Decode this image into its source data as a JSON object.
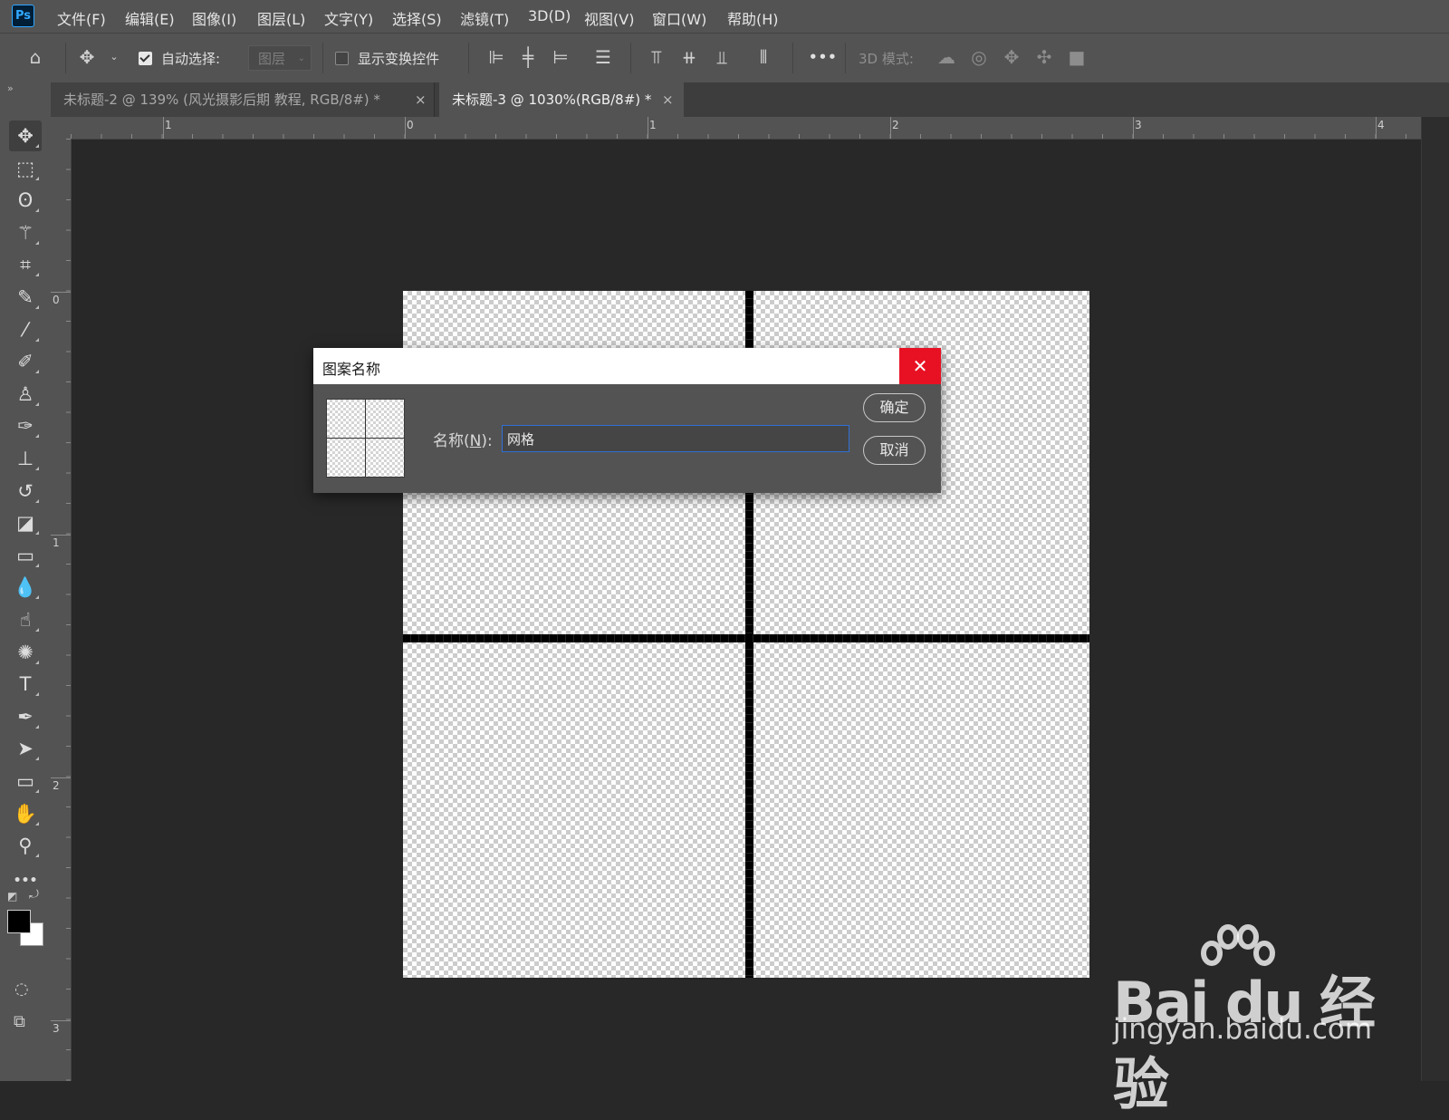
{
  "app": {
    "logo_text": "Ps"
  },
  "menu": [
    "文件(F)",
    "编辑(E)",
    "图像(I)",
    "图层(L)",
    "文字(Y)",
    "选择(S)",
    "滤镜(T)",
    "3D(D)",
    "视图(V)",
    "窗口(W)",
    "帮助(H)"
  ],
  "options_bar": {
    "auto_select_label": "自动选择:",
    "auto_select_checked": true,
    "layer_select_value": "图层",
    "show_transform_label": "显示变换控件",
    "show_transform_checked": false,
    "mode_3d_label": "3D 模式:",
    "more_label": "•••"
  },
  "tabs": [
    {
      "title": "未标题-2 @ 139% (风光摄影后期 教程, RGB/8#) *",
      "close": "×",
      "active": false
    },
    {
      "title": "未标题-3 @ 1030%(RGB/8#) *",
      "close": "×",
      "active": true
    }
  ],
  "rulers": {
    "horizontal": [
      "1",
      "0",
      "1",
      "2",
      "3",
      "4"
    ],
    "vertical": [
      "0",
      "1",
      "2",
      "3"
    ]
  },
  "toolbar": {
    "tools": [
      {
        "name": "move-tool",
        "glyph": "✥",
        "active": true
      },
      {
        "name": "marquee-tool",
        "glyph": "⬚"
      },
      {
        "name": "lasso-tool",
        "glyph": "ʘ"
      },
      {
        "name": "magic-wand-tool",
        "glyph": "⚚"
      },
      {
        "name": "crop-tool",
        "glyph": "⌗"
      },
      {
        "name": "eyedropper-tool",
        "glyph": "✎"
      },
      {
        "name": "healing-brush-tool",
        "glyph": "⁄"
      },
      {
        "name": "brush-tool",
        "glyph": "✐"
      },
      {
        "name": "clone-stamp-tool",
        "glyph": "♙"
      },
      {
        "name": "mixer-brush-tool",
        "glyph": "✑"
      },
      {
        "name": "stamp-tool",
        "glyph": "⊥"
      },
      {
        "name": "history-brush-tool",
        "glyph": "↺"
      },
      {
        "name": "eraser-tool",
        "glyph": "◪"
      },
      {
        "name": "gradient-tool",
        "glyph": "▭"
      },
      {
        "name": "blur-tool",
        "glyph": "💧"
      },
      {
        "name": "smudge-tool",
        "glyph": "☝"
      },
      {
        "name": "sponge-tool",
        "glyph": "✺"
      },
      {
        "name": "type-tool",
        "glyph": "T"
      },
      {
        "name": "pen-tool",
        "glyph": "✒"
      },
      {
        "name": "path-selection-tool",
        "glyph": "➤"
      },
      {
        "name": "rectangle-tool",
        "glyph": "▭"
      },
      {
        "name": "hand-tool",
        "glyph": "✋"
      },
      {
        "name": "zoom-tool",
        "glyph": "⚲"
      },
      {
        "name": "more-tools",
        "glyph": "•••"
      }
    ],
    "foreground_color": "#000000",
    "background_color": "#ffffff"
  },
  "dialog": {
    "title": "图案名称",
    "close_glyph": "✕",
    "name_label_pre": "名称(",
    "name_label_key": "N",
    "name_label_post": "):",
    "name_value": "网格",
    "ok_label": "确定",
    "cancel_label": "取消"
  },
  "watermark": {
    "brand": "Bai du 经验",
    "url": "jingyan.baidu.com"
  },
  "colors": {
    "close_button": "#e81123",
    "input_focus": "#2f6fd6",
    "panel": "#535353",
    "workspace": "#282828"
  }
}
